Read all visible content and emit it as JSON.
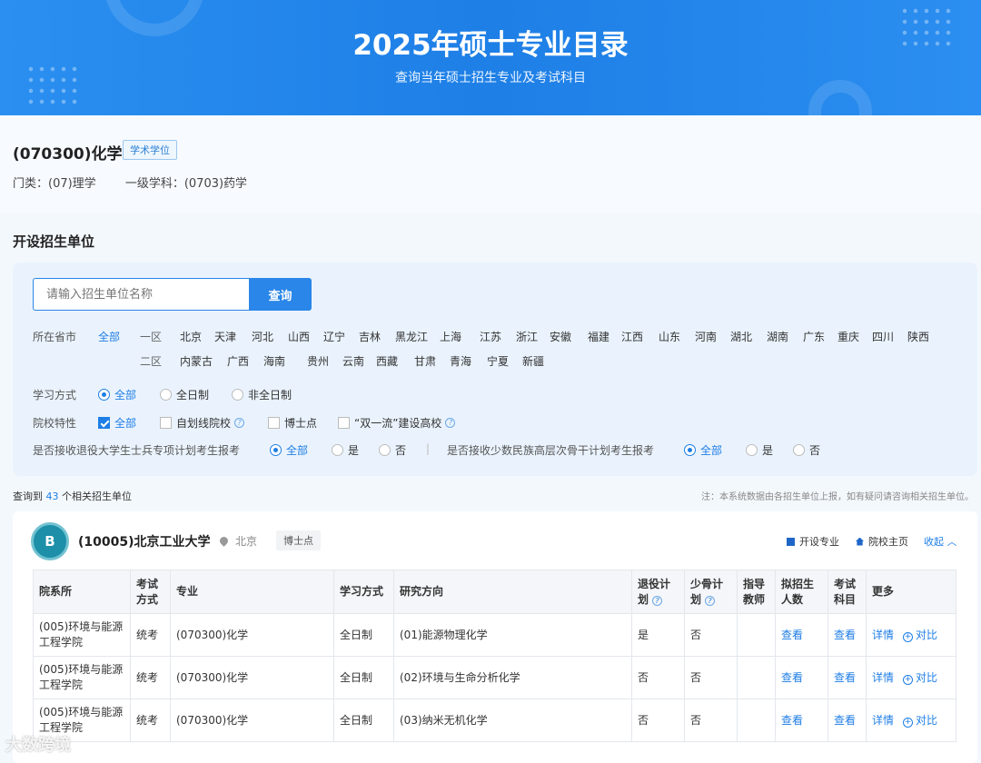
{
  "banner": {
    "title": "2025年硕士专业目录",
    "subtitle": "查询当年硕士招生专业及考试科目"
  },
  "major": {
    "title": "(070300)化学",
    "tag": "学术学位",
    "category": "门类：(07)理学",
    "discipline": "一级学科：(0703)药学"
  },
  "section_title": "开设招生单位",
  "search": {
    "placeholder": "请输入招生单位名称",
    "button": "查询"
  },
  "province_filter": {
    "label": "所在省市",
    "all": "全部",
    "zone1_label": "一区",
    "zone1": [
      "北京",
      "天津",
      "河北",
      "山西",
      "辽宁",
      "吉林",
      "黑龙江",
      "上海",
      "江苏",
      "浙江",
      "安徽",
      "福建",
      "江西",
      "山东",
      "河南",
      "湖北",
      "湖南",
      "广东",
      "重庆",
      "四川",
      "陕西"
    ],
    "zone2_label": "二区",
    "zone2": [
      "内蒙古",
      "广西",
      "海南",
      "贵州",
      "云南",
      "西藏",
      "甘肃",
      "青海",
      "宁夏",
      "新疆"
    ]
  },
  "study_mode": {
    "label": "学习方式",
    "options": [
      "全部",
      "全日制",
      "非全日制"
    ],
    "selected": "全部"
  },
  "school_feature": {
    "label": "院校特性",
    "options": [
      "全部",
      "自划线院校",
      "博士点",
      "“双一流”建设高校"
    ]
  },
  "veteran_plan": {
    "label": "是否接收退役大学生士兵专项计划考生报考",
    "options": [
      "全部",
      "是",
      "否"
    ]
  },
  "minority_plan": {
    "label": "是否接收少数民族高层次骨干计划考生报考",
    "options": [
      "全部",
      "是",
      "否"
    ]
  },
  "separator": "|",
  "result": {
    "prefix": "查询到",
    "count": "43",
    "suffix": "个相关招生单位",
    "note": "注：本系统数据由各招生单位上报，如有疑问请咨询相关招生单位。"
  },
  "university": {
    "logo_text": "B",
    "name": "(10005)北京工业大学",
    "location": "北京",
    "tag": "博士点",
    "links": [
      "开设专业",
      "院校主页"
    ],
    "collapse": "收起 ︿"
  },
  "table": {
    "headers": [
      "院系所",
      "考试方式",
      "专业",
      "学习方式",
      "研究方向",
      "退役计划",
      "少骨计划",
      "指导教师",
      "拟招生人数",
      "考试科目",
      "更多"
    ],
    "rows": [
      {
        "dept": "(005)环境与能源工程学院",
        "exam": "统考",
        "major": "(070300)化学",
        "mode": "全日制",
        "direction": "(01)能源物理化学",
        "veteran": "是",
        "minority": "否",
        "advisor": "",
        "quota": "查看",
        "subjects": "查看",
        "detail": "详情",
        "compare": "对比"
      },
      {
        "dept": "(005)环境与能源工程学院",
        "exam": "统考",
        "major": "(070300)化学",
        "mode": "全日制",
        "direction": "(02)环境与生命分析化学",
        "veteran": "否",
        "minority": "否",
        "advisor": "",
        "quota": "查看",
        "subjects": "查看",
        "detail": "详情",
        "compare": "对比"
      },
      {
        "dept": "(005)环境与能源工程学院",
        "exam": "统考",
        "major": "(070300)化学",
        "mode": "全日制",
        "direction": "(03)纳米无机化学",
        "veteran": "否",
        "minority": "否",
        "advisor": "",
        "quota": "查看",
        "subjects": "查看",
        "detail": "详情",
        "compare": "对比"
      }
    ]
  },
  "watermark": "大数跨境",
  "colors": {
    "accent": "#1f7ee6",
    "banner": "#2a8ff0"
  }
}
